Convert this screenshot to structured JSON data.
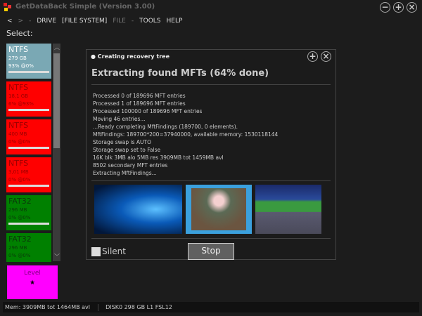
{
  "window": {
    "title": "GetDataBack Simple (Version 3.00)"
  },
  "menu": {
    "back": "<",
    "forward": ">",
    "sep1": "-",
    "drive": "DRIVE",
    "file_system": "[FILE SYSTEM]",
    "file": "FILE",
    "sep2": "-",
    "tools": "TOOLS",
    "help": "HELP"
  },
  "select_label": "Select:",
  "partitions": [
    {
      "fs": "NTFS",
      "size": "279 GB",
      "progress": "93% @0%",
      "color": "#7aa8b4"
    },
    {
      "fs": "NTFS",
      "size": "18,1 GB",
      "progress": "6% @93%",
      "color": "#ff0000"
    },
    {
      "fs": "NTFS",
      "size": "400 MB",
      "progress": "0% @0%",
      "color": "#ff0000"
    },
    {
      "fs": "NTFS",
      "size": "3,01 MB",
      "progress": "0% @0%",
      "color": "#ff0000"
    },
    {
      "fs": "FAT32",
      "size": "296 MB",
      "progress": "0% @0%",
      "color": "#008000"
    },
    {
      "fs": "FAT32",
      "size": "296 MB",
      "progress": "0% @0%",
      "color": "#008000"
    }
  ],
  "level": {
    "label": "Level",
    "star": "★"
  },
  "dialog": {
    "header": "Creating recovery tree",
    "title": "Extracting found MFTs (64% done)",
    "percent_done": 64,
    "log": [
      "Processed 0 of 189696 MFT entries",
      "Processed 1 of 189696 MFT entries",
      "Processed 100000 of 189696 MFT entries",
      "Moving 46 entries...",
      "...Ready completing MftFindings (189700, 0 elements).",
      "MftFindings: 189700*200=37940000, available memory: 1530118144",
      "Storage swap is AUTO",
      "Storage swap set to False",
      "16K blk 3MB alo 5MB res 3909MB tot 1459MB avl",
      "8502 secondary MFT entries",
      "Extracting MftFindings..."
    ],
    "silent_label": "Silent",
    "stop_label": "Stop"
  },
  "status": {
    "mem": "Mem: 3909MB tot 1464MB avl",
    "disk": "DISK0 298 GB L1 FSL12"
  }
}
